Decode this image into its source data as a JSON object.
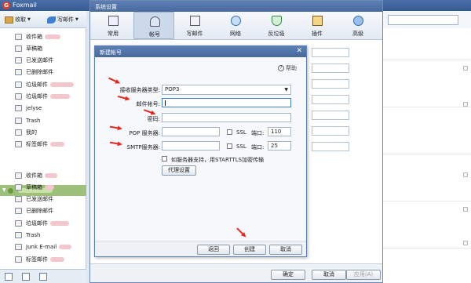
{
  "app": {
    "title": "Foxmail"
  },
  "toolbar": {
    "inbox_label": "收取",
    "compose_label": "写邮件"
  },
  "account1": {
    "folders": [
      {
        "label": "收件箱",
        "icon": "inbox-icon"
      },
      {
        "label": "草稿箱",
        "icon": "drafts-icon"
      },
      {
        "label": "已发送邮件",
        "icon": "sent-icon"
      },
      {
        "label": "已删除邮件",
        "icon": "trash-icon"
      },
      {
        "label": "垃圾邮件",
        "icon": "junk-icon"
      },
      {
        "label": "垃圾邮件",
        "icon": "folder-icon"
      },
      {
        "label": "jelyse",
        "icon": "folder-icon"
      },
      {
        "label": "Trash",
        "icon": "folder-icon"
      },
      {
        "label": "我的",
        "icon": "folder-icon"
      },
      {
        "label": "标签邮件",
        "icon": "folder-icon"
      }
    ]
  },
  "account2": {
    "folders": [
      {
        "label": "收件箱",
        "icon": "inbox-icon"
      },
      {
        "label": "草稿箱",
        "icon": "drafts-icon"
      },
      {
        "label": "已发送邮件",
        "icon": "sent-icon"
      },
      {
        "label": "已删除邮件",
        "icon": "trash-icon"
      },
      {
        "label": "垃圾邮件",
        "icon": "junk-icon"
      },
      {
        "label": "Trash",
        "icon": "folder-icon"
      },
      {
        "label": "Junk E-mail",
        "icon": "folder-icon"
      },
      {
        "label": "标签邮件",
        "icon": "folder-icon"
      }
    ]
  },
  "settings": {
    "title": "系统设置",
    "tabs": [
      {
        "label": "常用",
        "icon": "general-icon"
      },
      {
        "label": "帐号",
        "icon": "account-icon"
      },
      {
        "label": "写邮件",
        "icon": "compose-icon"
      },
      {
        "label": "网络",
        "icon": "network-icon"
      },
      {
        "label": "反垃圾",
        "icon": "antispam-icon"
      },
      {
        "label": "插件",
        "icon": "plugin-icon"
      },
      {
        "label": "高级",
        "icon": "advanced-icon"
      }
    ],
    "ok_label": "确定",
    "cancel_label": "取消",
    "apply_label": "应用(A)"
  },
  "new_account": {
    "title": "新建帐号",
    "help_label": "帮助",
    "server_type_label": "接收服务器类型:",
    "server_type_value": "POP3",
    "email_label": "邮件帐号:",
    "password_label": "密码:",
    "pop_label": "POP 服务器:",
    "smtp_label": "SMTP服务器:",
    "ssl_label": "SSL",
    "port_label": "端口:",
    "pop_port": "110",
    "smtp_port": "25",
    "starttls_label": "如服务器支持，用STARTTLS加密传输",
    "proxy_label": "代理设置",
    "back_label": "返回",
    "create_label": "创建",
    "cancel_label": "取消"
  },
  "colors": {
    "accent": "#48699c",
    "annotation_arrow": "#e8261c",
    "account_header": "#9dc07a"
  }
}
